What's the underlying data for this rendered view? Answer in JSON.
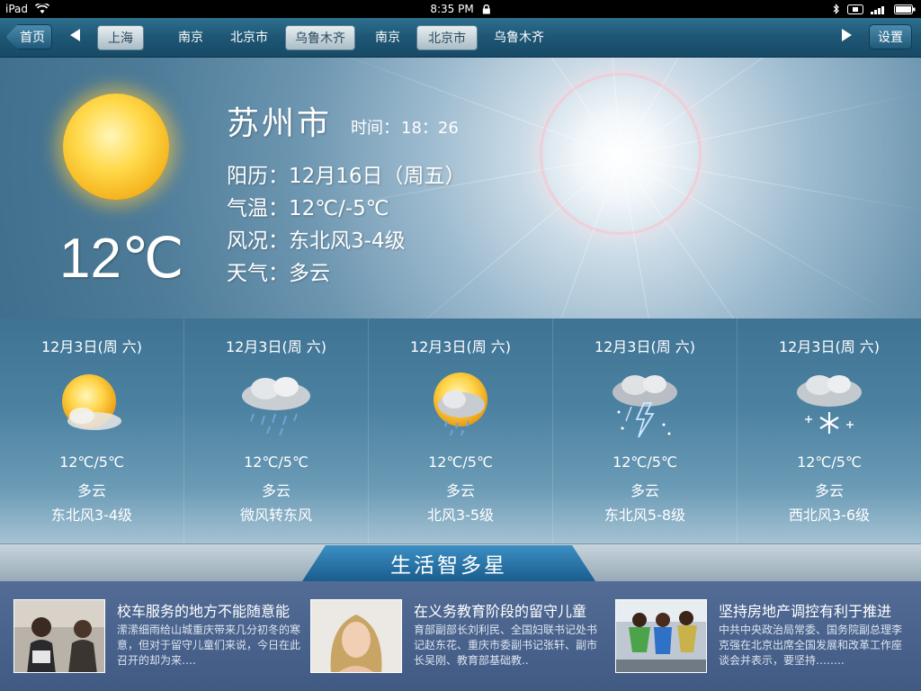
{
  "status_bar": {
    "device": "iPad",
    "time": "8:35 PM"
  },
  "nav": {
    "home_label": "首页",
    "settings_label": "设置",
    "cities": [
      "上海",
      "南京",
      "北京市",
      "乌鲁木齐",
      "南京",
      "北京市",
      "乌鲁木齐"
    ],
    "selected_indices": [
      0,
      3,
      5
    ]
  },
  "current": {
    "city": "苏州市",
    "time_label": "时间：",
    "time_value": "18：26",
    "date_line": "阳历：12月16日（周五）",
    "temp_line": "气温：12℃/-5℃",
    "wind_line": "风况：东北风3-4级",
    "weather_line": "天气：多云",
    "temperature": "12℃",
    "icon": "sun-icon"
  },
  "forecast": [
    {
      "date": "12月3日(周 六)",
      "temp": "12℃/5℃",
      "condition": "多云",
      "wind": "东北风3-4级",
      "icon": "partly-cloudy-icon"
    },
    {
      "date": "12月3日(周 六)",
      "temp": "12℃/5℃",
      "condition": "多云",
      "wind": "微风转东风",
      "icon": "rain-icon"
    },
    {
      "date": "12月3日(周 六)",
      "temp": "12℃/5℃",
      "condition": "多云",
      "wind": "北风3-5级",
      "icon": "sun-cloud-rain-icon"
    },
    {
      "date": "12月3日(周 六)",
      "temp": "12℃/5℃",
      "condition": "多云",
      "wind": "东北风5-8级",
      "icon": "thunderstorm-icon"
    },
    {
      "date": "12月3日(周 六)",
      "temp": "12℃/5℃",
      "condition": "多云",
      "wind": "西北风3-6级",
      "icon": "snow-icon"
    }
  ],
  "life": {
    "title": "生活智多星",
    "news": [
      {
        "title": "校车服务的地方不能随意能",
        "body": "潆潆细雨给山城重庆带来几分初冬的寒意，但对于留守儿童们来说，今日在此召开的却为来….",
        "thumb": "news-photo-crowd"
      },
      {
        "title": "在义务教育阶段的留守儿童",
        "body": "育部副部长刘利民、全国妇联书记处书记赵东花、重庆市委副书记张轩、副市长吴刚、教育部基础教..",
        "thumb": "news-photo-portrait"
      },
      {
        "title": "坚持房地产调控有利于推进",
        "body": "中共中央政治局常委、国务院副总理李克强在北京出席全国发展和改革工作座谈会并表示，要坚持……..",
        "thumb": "news-photo-performers"
      }
    ]
  }
}
